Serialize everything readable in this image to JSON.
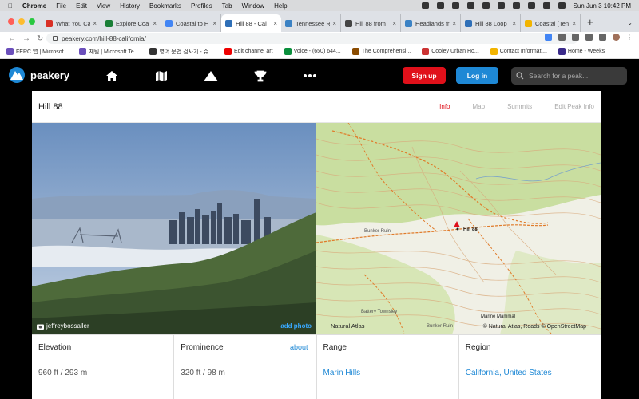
{
  "menubar": {
    "app": "Chrome",
    "items": [
      "File",
      "Edit",
      "View",
      "History",
      "Bookmarks",
      "Profiles",
      "Tab",
      "Window",
      "Help"
    ],
    "clock": "Sun Jun 3  10:42 PM"
  },
  "tabs": [
    {
      "title": "What You Ca",
      "color": "#d93025"
    },
    {
      "title": "Explore Coa",
      "color": "#1a7f37"
    },
    {
      "title": "Coastal to H",
      "color": "#4285f4"
    },
    {
      "title": "Hill 88 - Cal",
      "color": "#2f6fb7",
      "active": true
    },
    {
      "title": "Tennessee R",
      "color": "#3b82c4"
    },
    {
      "title": "Hill 88 from",
      "color": "#444"
    },
    {
      "title": "Headlands fr",
      "color": "#3b82c4"
    },
    {
      "title": "Hill 88 Loop",
      "color": "#2f6fb7"
    },
    {
      "title": "Coastal (Ten",
      "color": "#f2b400"
    }
  ],
  "address": {
    "url": "peakery.com/hill-88-california/"
  },
  "bookmarks": [
    {
      "label": "FERC 앱 | Microsof...",
      "color": "#6b4fbb"
    },
    {
      "label": "재팀 | Microsoft Te...",
      "color": "#6b4fbb"
    },
    {
      "label": "영어 문법 검사기 - 슈...",
      "color": "#333"
    },
    {
      "label": "Edit channel art",
      "color": "#e00"
    },
    {
      "label": "Voice - (650) 644...",
      "color": "#0a8f3c"
    },
    {
      "label": "The Comprehensi...",
      "color": "#8a4b00"
    },
    {
      "label": "Cooley Urban Ho...",
      "color": "#c33"
    },
    {
      "label": "Contact Informati...",
      "color": "#f2b400"
    },
    {
      "label": "Home - Weeks",
      "color": "#3a2a8a"
    }
  ],
  "site": {
    "brand": "peakery",
    "signup": "Sign up",
    "login": "Log in",
    "search_placeholder": "Search for a peak...",
    "accent_red": "#e0101a",
    "accent_blue": "#1e88d5"
  },
  "peak": {
    "title": "Hill 88",
    "tabs": [
      "Info",
      "Map",
      "Summits",
      "Edit Peak Info"
    ],
    "photo_credit": "jeffreybossaller",
    "add_photo": "add photo",
    "map": {
      "label_peak": "Hill 88",
      "label_bunker": "Bunker Ruin",
      "label_bunker2": "Bunker Ruin",
      "label_battery": "Battery Townsley",
      "label_mammal": "Marine Mammal",
      "attribution_left": "Natural Atlas",
      "attribution_right": "© Natural Atlas, Roads © OpenStreetMap"
    },
    "stats": {
      "elevation_label": "Elevation",
      "elevation_value": "960 ft / 293 m",
      "prominence_label": "Prominence",
      "prominence_value": "320 ft / 98 m",
      "about": "about",
      "range_label": "Range",
      "range_value": "Marin Hills",
      "region_label": "Region",
      "region_value": "California, United States"
    }
  }
}
